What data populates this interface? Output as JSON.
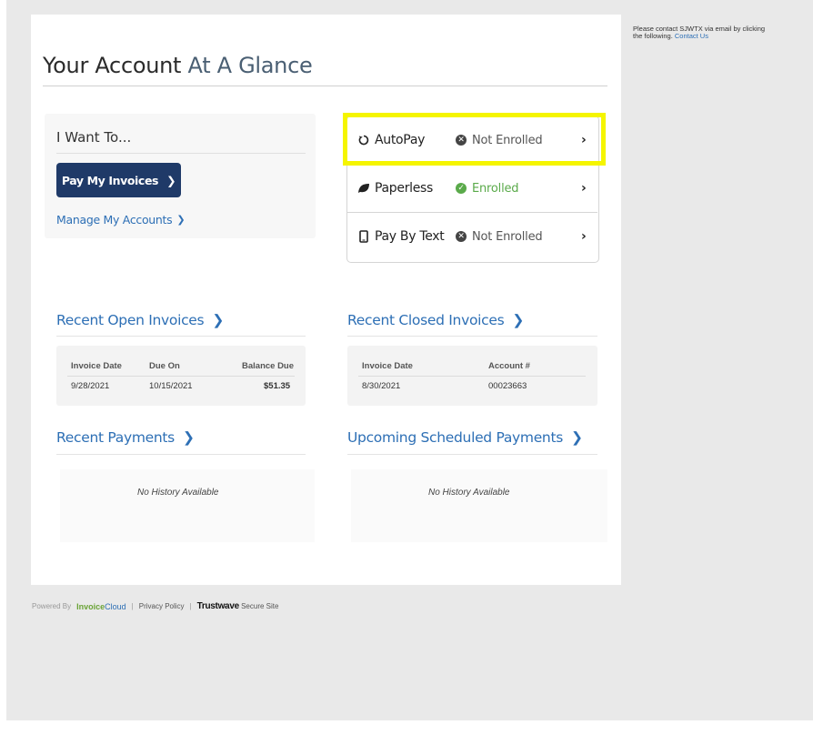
{
  "title": {
    "part1": "Your Account",
    "part2": "At A Glance"
  },
  "iwant": {
    "title": "I Want To...",
    "pay_button": "Pay My Invoices",
    "manage_link": "Manage My Accounts"
  },
  "enrollment": [
    {
      "name": "AutoPay",
      "status": "Not Enrolled",
      "status_color": "#555555",
      "icon": "refresh-icon"
    },
    {
      "name": "Paperless",
      "status": "Enrolled",
      "status_color": "#5aaa4a",
      "icon": "leaf-icon"
    },
    {
      "name": "Pay By Text",
      "status": "Not Enrolled",
      "status_color": "#555555",
      "icon": "phone-icon"
    }
  ],
  "open_invoices": {
    "title": "Recent Open Invoices",
    "headers": [
      "Invoice Date",
      "Due On",
      "Balance Due"
    ],
    "rows": [
      [
        "9/28/2021",
        "10/15/2021",
        "$51.35"
      ]
    ]
  },
  "closed_invoices": {
    "title": "Recent Closed Invoices",
    "headers": [
      "Invoice Date",
      "Account #"
    ],
    "rows": [
      [
        "8/30/2021",
        "00023663"
      ]
    ]
  },
  "recent_payments": {
    "title": "Recent Payments",
    "empty": "No History Available"
  },
  "scheduled_payments": {
    "title": "Upcoming Scheduled Payments",
    "empty": "No History Available"
  },
  "footer": {
    "powered_by": "Powered By",
    "brand_a": "Invoice",
    "brand_b": "Cloud",
    "privacy": "Privacy Policy",
    "trustwave": "Trustwave",
    "secure": "Secure Site"
  },
  "side_note": {
    "text": "Please contact SJWTX via email by clicking the following.",
    "link": "Contact Us"
  },
  "colors": {
    "accent": "#2d6fb5",
    "button": "#1f3a68",
    "highlight": "#f5f500"
  }
}
